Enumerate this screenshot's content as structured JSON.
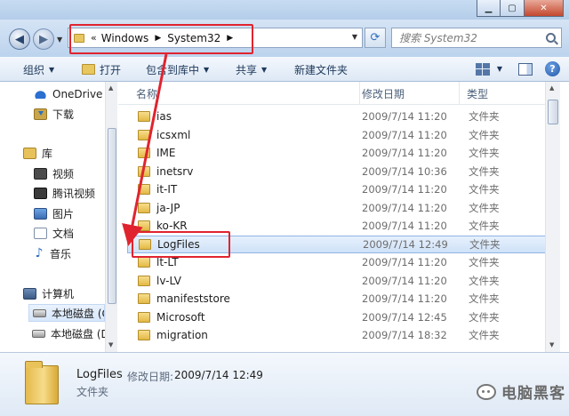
{
  "address": {
    "crumb_prefix": "«",
    "crumbs": [
      "Windows",
      "System32"
    ],
    "search_placeholder": "搜索 System32"
  },
  "toolbar": {
    "organize": "组织",
    "open": "打开",
    "include_in_library": "包含到库中",
    "share": "共享",
    "new_folder": "新建文件夹"
  },
  "sidebar": {
    "items": [
      {
        "label": "OneDrive",
        "icon": "cloud-icon"
      },
      {
        "label": "下载",
        "icon": "download-folder-icon"
      },
      {
        "label": "库",
        "icon": "library-icon"
      },
      {
        "label": "视频",
        "icon": "video-icon"
      },
      {
        "label": "腾讯视频",
        "icon": "tencent-video-icon"
      },
      {
        "label": "图片",
        "icon": "picture-icon"
      },
      {
        "label": "文档",
        "icon": "document-icon"
      },
      {
        "label": "音乐",
        "icon": "music-icon"
      },
      {
        "label": "计算机",
        "icon": "computer-icon"
      },
      {
        "label": "本地磁盘 (C",
        "icon": "disk-icon"
      },
      {
        "label": "本地磁盘 (D",
        "icon": "disk-icon"
      }
    ]
  },
  "columns": {
    "name": "名称",
    "date": "修改日期",
    "type": "类型"
  },
  "files": [
    {
      "name": "ias",
      "date": "2009/7/14 11:20",
      "type": "文件夹"
    },
    {
      "name": "icsxml",
      "date": "2009/7/14 11:20",
      "type": "文件夹"
    },
    {
      "name": "IME",
      "date": "2009/7/14 11:20",
      "type": "文件夹"
    },
    {
      "name": "inetsrv",
      "date": "2009/7/14 10:36",
      "type": "文件夹"
    },
    {
      "name": "it-IT",
      "date": "2009/7/14 11:20",
      "type": "文件夹"
    },
    {
      "name": "ja-JP",
      "date": "2009/7/14 11:20",
      "type": "文件夹"
    },
    {
      "name": "ko-KR",
      "date": "2009/7/14 11:20",
      "type": "文件夹"
    },
    {
      "name": "LogFiles",
      "date": "2009/7/14 12:49",
      "type": "文件夹",
      "selected": true
    },
    {
      "name": "lt-LT",
      "date": "2009/7/14 11:20",
      "type": "文件夹"
    },
    {
      "name": "lv-LV",
      "date": "2009/7/14 11:20",
      "type": "文件夹"
    },
    {
      "name": "manifeststore",
      "date": "2009/7/14 11:20",
      "type": "文件夹"
    },
    {
      "name": "Microsoft",
      "date": "2009/7/14 12:45",
      "type": "文件夹"
    },
    {
      "name": "migration",
      "date": "2009/7/14 18:32",
      "type": "文件夹"
    }
  ],
  "details": {
    "name": "LogFiles",
    "modified_label": "修改日期:",
    "modified_value": "2009/7/14 12:49",
    "type": "文件夹"
  },
  "watermark": "电脑黑客",
  "colors": {
    "highlight_red": "#e0242f",
    "selection_blue": "#cfe2f8"
  }
}
